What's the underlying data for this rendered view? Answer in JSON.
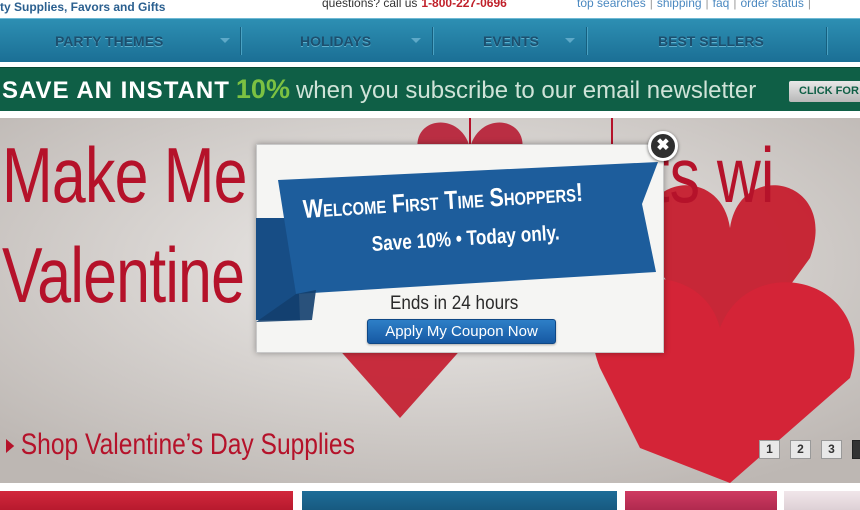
{
  "header": {
    "tagline": "ty Supplies, Favors and Gifts",
    "questions": "questions? call us",
    "phone": "1-800-227-0696",
    "links": [
      "top searches",
      "shipping",
      "faq",
      "order status"
    ]
  },
  "nav": {
    "items": [
      "PARTY THEMES",
      "HOLIDAYS",
      "EVENTS",
      "BEST SELLERS"
    ]
  },
  "promo": {
    "part1": "SAVE AN INSTANT",
    "part2": "10%",
    "part3": "when you subscribe to our email newsletter",
    "button": "CLICK FOR"
  },
  "hero": {
    "line1": "Make Me",
    "line1_right": "ents wi",
    "line2": "Valentine",
    "shop_link": "Shop Valentine’s Day Supplies",
    "pager": [
      "1",
      "2",
      "3"
    ]
  },
  "modal": {
    "welcome": "Welcome First Time Shoppers!",
    "save": "Save 10% • Today only.",
    "ends": "Ends in 24 hours",
    "button": "Apply My Coupon Now",
    "close_glyph": "✖"
  },
  "colors": {
    "nav": "#1b6f95",
    "promo": "#0f5f46",
    "hero_red": "#b5122a",
    "ribbon": "#1d5d9c"
  }
}
